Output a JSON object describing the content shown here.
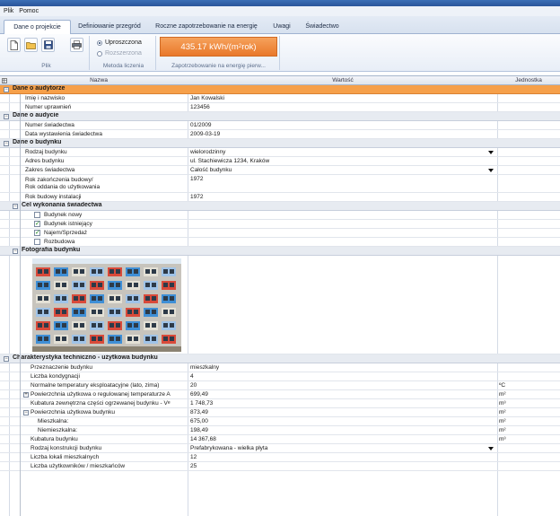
{
  "menu": {
    "file": "Plik",
    "help": "Pomoc"
  },
  "tabs": [
    {
      "label": "Dane o projekcie",
      "active": true
    },
    {
      "label": "Definiowanie przegród",
      "active": false
    },
    {
      "label": "Roczne zapotrzebowanie na energię",
      "active": false
    },
    {
      "label": "Uwagi",
      "active": false
    },
    {
      "label": "Świadectwo",
      "active": false
    }
  ],
  "ribbon": {
    "group_file": "Plik",
    "group_method": "Metoda liczenia",
    "group_demand": "Zapotrzebowanie na energię pierw...",
    "radio_simple": "Uproszczona",
    "radio_extended": "Rozszerzona",
    "energy_value": "435.17 kWh/(m",
    "energy_sup": "2",
    "energy_suffix": "rok)",
    "icons": [
      "new-document-icon",
      "open-folder-icon",
      "save-icon",
      "print-icon"
    ]
  },
  "columns": {
    "name": "Nazwa",
    "value": "Wartość",
    "unit": "Jednostka"
  },
  "sections": {
    "auditor": "Dane o audytorze",
    "audit": "Dane o audycie",
    "building": "Dane o budynku",
    "purpose": "Cel wykonania świadectwa",
    "photo": "Fotografia budynku",
    "tech": "Charakterystyka techniczno - użytkowa budynku"
  },
  "rows": {
    "auditor_name_label": "Imię i nazwisko",
    "auditor_name_value": "Jan Kowalski",
    "auditor_license_label": "Numer uprawnień",
    "auditor_license_value": "123456",
    "cert_number_label": "Numer świadectwa",
    "cert_number_value": "01/2009",
    "issue_date_label": "Data wystawienia świadectwa",
    "issue_date_value": "2009-03-19",
    "building_type_label": "Rodzaj budynku",
    "building_type_value": "wielorodzinny",
    "address_label": "Adres budynku",
    "address_value": "ul. Stachiewicza 1234, Kraków",
    "scope_label": "Zakres świadectwa",
    "scope_value": "Całość budynku",
    "completion_label": "Rok zakończenia budowy/\nRok oddania do użytkowania",
    "completion_value": "1972",
    "install_year_label": "Rok budowy instalacji",
    "install_year_value": "1972",
    "purpose_new": "Budynek nowy",
    "purpose_existing": "Budynek istniejący",
    "purpose_rent": "Najem/Sprzedaż",
    "purpose_extension": "Rozbudowa",
    "use_label": "Przeznaczenie budynku",
    "use_value": "mieszkalny",
    "floors_label": "Liczba kondygnacji",
    "floors_value": "4",
    "temp_label": "Normalne temperatury eksploatacyjne (lato, zima)",
    "temp_value": "20",
    "temp_unit": "ºC",
    "area_reg_label": "Powierzchnia użytkowa o regulowanej temperaturze A",
    "area_reg_value": "699,49",
    "area_reg_unit": "m²",
    "volume_label": "Kubatura zewnętrzna części ogrzewanej budynku - V",
    "volume_sub": "e",
    "volume_value": "1 748,73",
    "volume_unit": "m³",
    "usable_label": "Powierzchnia użytkowa budynku",
    "usable_value": "873,49",
    "usable_unit": "m²",
    "residential_label": "Mieszkalna:",
    "residential_value": "675,00",
    "residential_unit": "m²",
    "nonresidential_label": "Niemieszkalna:",
    "nonresidential_value": "198,49",
    "nonresidential_unit": "m²",
    "cubature_label": "Kubatura budynku",
    "cubature_value": "14 367,68",
    "cubature_unit": "m³",
    "construction_label": "Rodzaj konstrukcji budynku",
    "construction_value": "Prefabrykowana - wielka płyta",
    "flats_label": "Liczba lokali mieszkalnych",
    "flats_value": "12",
    "residents_label": "Liczba użytkowników / mieszkańców",
    "residents_value": "25"
  }
}
